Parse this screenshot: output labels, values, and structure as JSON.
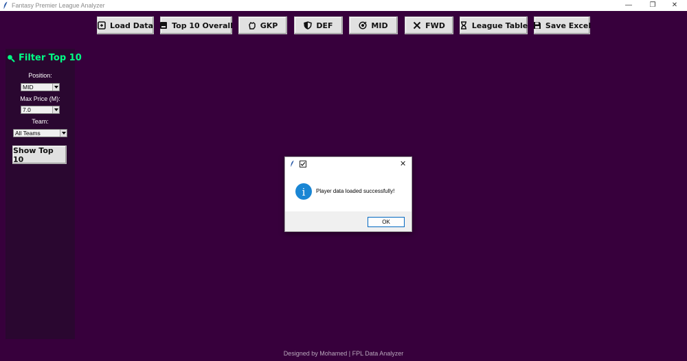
{
  "window": {
    "title": "Fantasy Premier League Analyzer",
    "controls": {
      "minimize": "—",
      "maximize": "❐",
      "close": "✕"
    }
  },
  "toolbar": {
    "buttons": [
      {
        "label": "Load Data",
        "icon": "load-icon"
      },
      {
        "label": "Top 10 Overall",
        "icon": "top10-icon"
      },
      {
        "label": "GKP",
        "icon": "goalkeeper-glove-icon"
      },
      {
        "label": "DEF",
        "icon": "shield-icon"
      },
      {
        "label": "MID",
        "icon": "target-icon"
      },
      {
        "label": "FWD",
        "icon": "crossed-swords-icon"
      },
      {
        "label": "League Table",
        "icon": "hourglass-icon"
      },
      {
        "label": "Save Excel",
        "icon": "floppy-disk-icon"
      }
    ]
  },
  "sidebar": {
    "title": "Filter Top 10",
    "title_icon": "search-icon",
    "position_label": "Position:",
    "position_value": "MID",
    "price_label": "Max Price (M):",
    "price_value": "7.0",
    "team_label": "Team:",
    "team_value": "All Teams",
    "show_button": "Show Top 10"
  },
  "dialog": {
    "message": "Player data loaded successfully!",
    "ok_label": "OK",
    "close_glyph": "✕",
    "icon": "info-icon",
    "info_glyph": "i"
  },
  "footer": {
    "text": "Designed by Mohamed | FPL Data Analyzer"
  },
  "colors": {
    "background": "#37003c",
    "sidebar": "#2a0730",
    "accent": "#00ff85",
    "info_blue": "#1a86d4"
  }
}
